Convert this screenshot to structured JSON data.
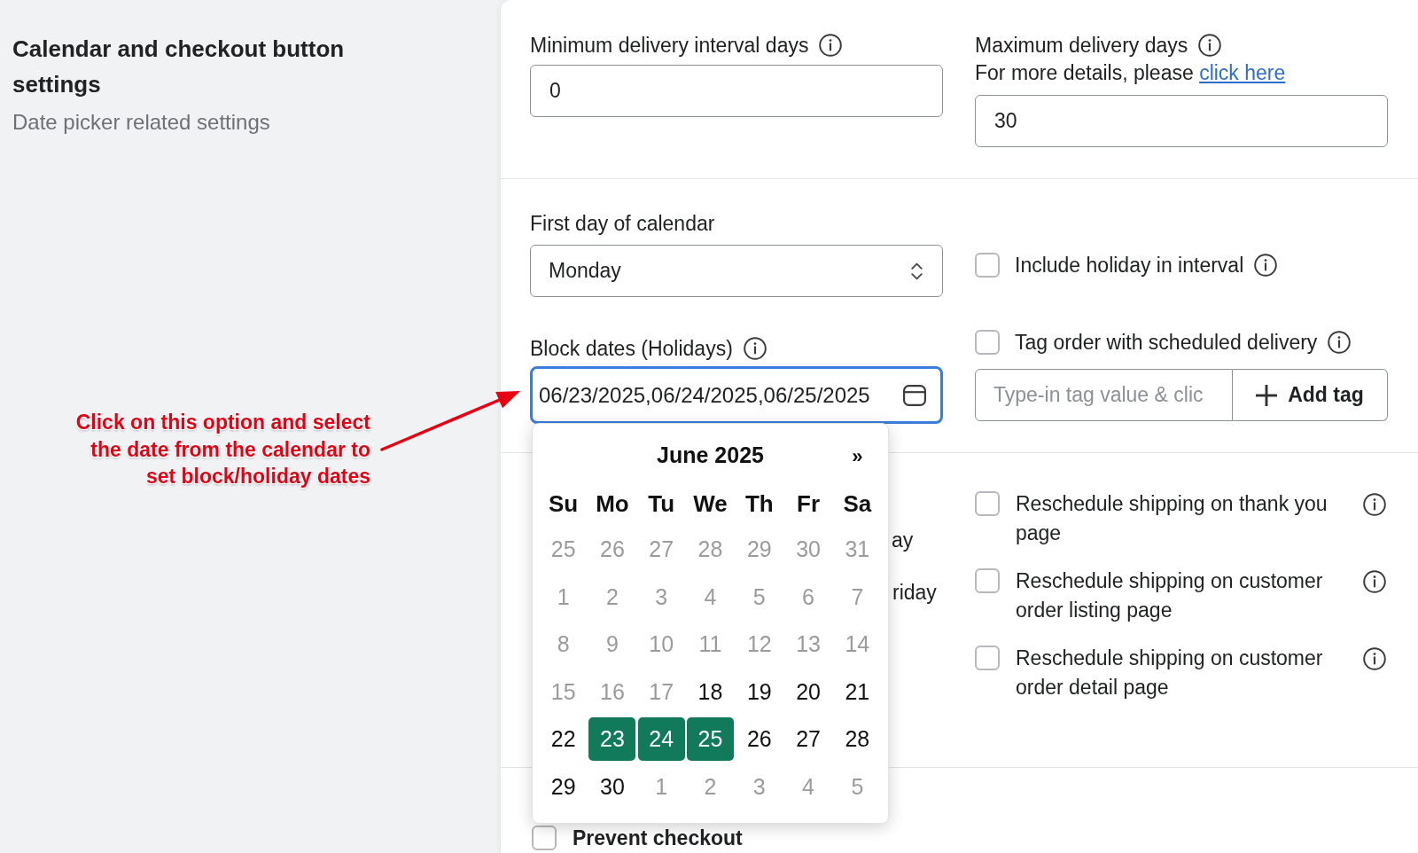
{
  "sidebar": {
    "title": "Calendar and checkout button settings",
    "subtitle": "Date picker related settings"
  },
  "annotation": {
    "lines": [
      "Click on this option and select",
      "the date from the calendar to",
      "set block/holiday dates"
    ]
  },
  "delivery_limits": {
    "minimum": {
      "label": "Minimum delivery interval days",
      "value": "0"
    },
    "maximum": {
      "label": "Maximum delivery days",
      "note": "For more details, please",
      "link": "click here",
      "value": "30"
    }
  },
  "calendar_settings": {
    "first_day": {
      "label": "First day of calendar",
      "value": "Monday"
    },
    "include_holiday": {
      "label": "Include holiday in interval",
      "checked": false
    },
    "block_dates": {
      "label": "Block dates (Holidays)",
      "value": "06/23/2025,06/24/2025,06/25/2025",
      "focused": true
    },
    "tag_order": {
      "label": "Tag order with scheduled delivery",
      "checked": false
    },
    "tag_input": {
      "placeholder": "Type-in tag value & clic"
    },
    "add_tag_button": "Add tag"
  },
  "date_picker": {
    "month": "June 2025",
    "next": "»",
    "weekdays": [
      "Su",
      "Mo",
      "Tu",
      "We",
      "Th",
      "Fr",
      "Sa"
    ],
    "weeks": [
      [
        {
          "day": "25",
          "disabled": true,
          "selected": false
        },
        {
          "day": "26",
          "disabled": true,
          "selected": false
        },
        {
          "day": "27",
          "disabled": true,
          "selected": false
        },
        {
          "day": "28",
          "disabled": true,
          "selected": false
        },
        {
          "day": "29",
          "disabled": true,
          "selected": false
        },
        {
          "day": "30",
          "disabled": true,
          "selected": false
        },
        {
          "day": "31",
          "disabled": true,
          "selected": false
        }
      ],
      [
        {
          "day": "1",
          "disabled": true,
          "selected": false
        },
        {
          "day": "2",
          "disabled": true,
          "selected": false
        },
        {
          "day": "3",
          "disabled": true,
          "selected": false
        },
        {
          "day": "4",
          "disabled": true,
          "selected": false
        },
        {
          "day": "5",
          "disabled": true,
          "selected": false
        },
        {
          "day": "6",
          "disabled": true,
          "selected": false
        },
        {
          "day": "7",
          "disabled": true,
          "selected": false
        }
      ],
      [
        {
          "day": "8",
          "disabled": true,
          "selected": false
        },
        {
          "day": "9",
          "disabled": true,
          "selected": false
        },
        {
          "day": "10",
          "disabled": true,
          "selected": false
        },
        {
          "day": "11",
          "disabled": true,
          "selected": false
        },
        {
          "day": "12",
          "disabled": true,
          "selected": false
        },
        {
          "day": "13",
          "disabled": true,
          "selected": false
        },
        {
          "day": "14",
          "disabled": true,
          "selected": false
        }
      ],
      [
        {
          "day": "15",
          "disabled": true,
          "selected": false
        },
        {
          "day": "16",
          "disabled": true,
          "selected": false
        },
        {
          "day": "17",
          "disabled": true,
          "selected": false
        },
        {
          "day": "18",
          "disabled": false,
          "selected": false
        },
        {
          "day": "19",
          "disabled": false,
          "selected": false
        },
        {
          "day": "20",
          "disabled": false,
          "selected": false
        },
        {
          "day": "21",
          "disabled": false,
          "selected": false
        }
      ],
      [
        {
          "day": "22",
          "disabled": false,
          "selected": false
        },
        {
          "day": "23",
          "disabled": false,
          "selected": true
        },
        {
          "day": "24",
          "disabled": false,
          "selected": true
        },
        {
          "day": "25",
          "disabled": false,
          "selected": true
        },
        {
          "day": "26",
          "disabled": false,
          "selected": false
        },
        {
          "day": "27",
          "disabled": false,
          "selected": false
        },
        {
          "day": "28",
          "disabled": false,
          "selected": false
        }
      ],
      [
        {
          "day": "29",
          "disabled": false,
          "selected": false
        },
        {
          "day": "30",
          "disabled": false,
          "selected": false
        },
        {
          "day": "1",
          "disabled": true,
          "selected": false
        },
        {
          "day": "2",
          "disabled": true,
          "selected": false
        },
        {
          "day": "3",
          "disabled": true,
          "selected": false
        },
        {
          "day": "4",
          "disabled": true,
          "selected": false
        },
        {
          "day": "5",
          "disabled": true,
          "selected": false
        }
      ]
    ]
  },
  "reschedule_section": {
    "covered_labels": [
      "ay",
      "riday"
    ],
    "options": [
      {
        "label": "Reschedule shipping on thank you page",
        "checked": false
      },
      {
        "label": "Reschedule shipping on customer order listing page",
        "checked": false
      },
      {
        "label": "Reschedule shipping on customer order detail page",
        "checked": false
      }
    ]
  },
  "checkout_section": {
    "prevent_checkout": {
      "label": "Prevent checkout",
      "checked": false
    }
  }
}
